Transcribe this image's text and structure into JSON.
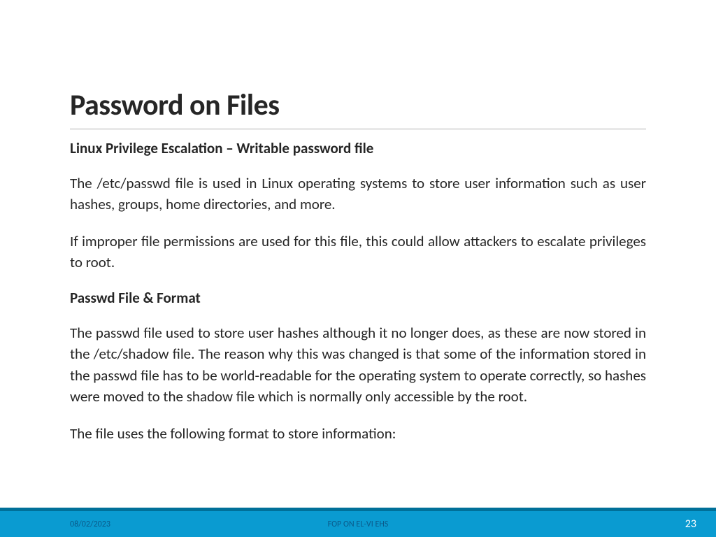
{
  "title": "Password on Files",
  "subheading1": "Linux Privilege Escalation – Writable password file",
  "para1": "The /etc/passwd file is used in Linux operating systems to store user information such as user hashes, groups, home directories, and more.",
  "para2": "If improper file permissions are used for this file, this could allow attackers to escalate privileges to root.",
  "subheading2": "Passwd File & Format",
  "para3": "The passwd file used to store user hashes although it no longer does, as these are now stored in the /etc/shadow file. The reason why this was changed is that some of the information stored in the passwd file has to be world-readable for the operating system to operate correctly, so hashes were moved to the shadow file which is normally only accessible by the root.",
  "para4": "The file uses the following format to store information:",
  "footer": {
    "date": "08/02/2023",
    "center": "FOP ON EL-VI EHS",
    "page": "23"
  }
}
